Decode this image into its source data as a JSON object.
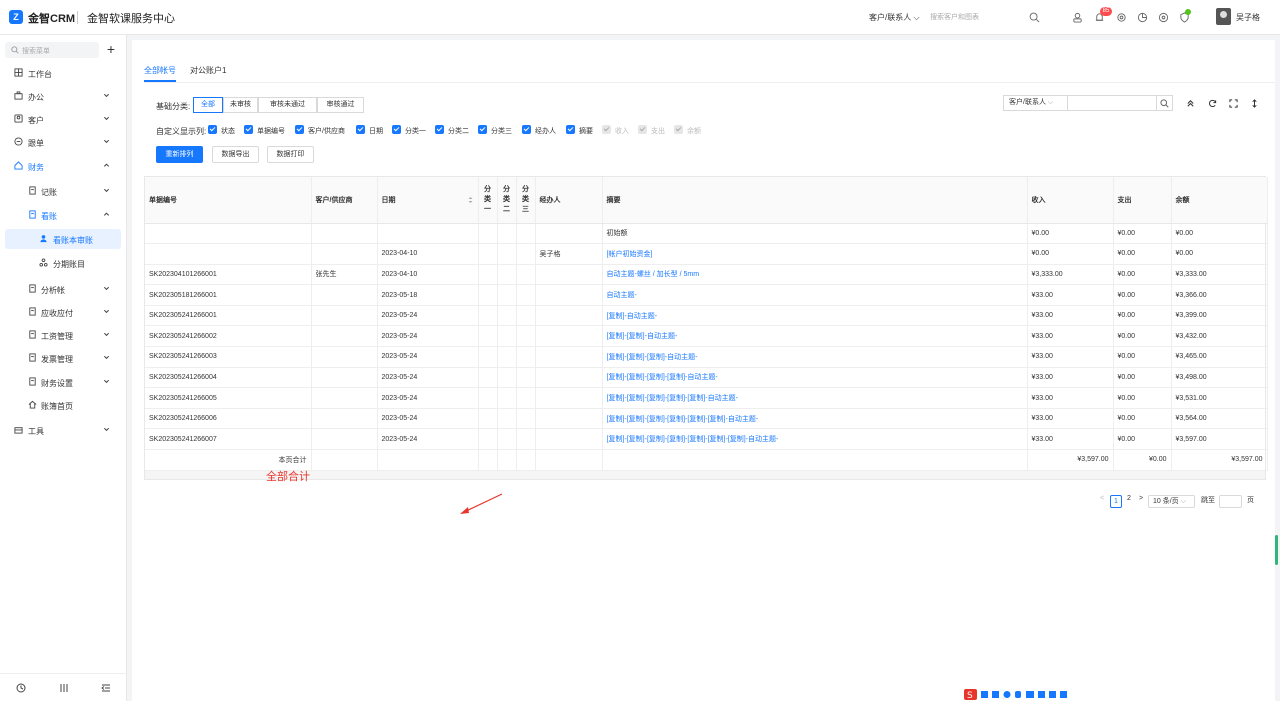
{
  "header": {
    "logo_text": "金智CRM",
    "center_name": "金智软课服务中心",
    "search_type": "客户/联系人",
    "search_placeholder": "搜索客户和图表",
    "notifications_count": "85",
    "user_name": "吴子格"
  },
  "sidebar": {
    "search_placeholder": "搜索菜单",
    "items": [
      {
        "label": "工作台",
        "icon": "grid-icon"
      },
      {
        "label": "办公",
        "icon": "briefcase-icon"
      },
      {
        "label": "客户",
        "icon": "customer-icon"
      },
      {
        "label": "跟单",
        "icon": "follow-icon"
      },
      {
        "label": "财务",
        "icon": "finance-icon"
      },
      {
        "label": "记账",
        "icon": "ledger-icon"
      },
      {
        "label": "看账",
        "icon": "view-ledger-icon"
      },
      {
        "label": "看账本审账",
        "icon": "user-icon"
      },
      {
        "label": "分期账目",
        "icon": "installment-icon"
      },
      {
        "label": "分析帐",
        "icon": "analysis-icon"
      },
      {
        "label": "应收应付",
        "icon": "receivable-icon"
      },
      {
        "label": "工资管理",
        "icon": "salary-icon"
      },
      {
        "label": "发票管理",
        "icon": "invoice-icon"
      },
      {
        "label": "财务设置",
        "icon": "settings-icon"
      },
      {
        "label": "账簿首页",
        "icon": "home-icon"
      },
      {
        "label": "工具",
        "icon": "tool-icon"
      }
    ]
  },
  "tabs": [
    {
      "label": "全部帐号"
    },
    {
      "label": "对公账户1"
    }
  ],
  "filter": {
    "base_label": "基础分类:",
    "segments": [
      "全部",
      "未审核",
      "审核未通过",
      "审核通过"
    ],
    "custom_label": "自定义显示列:",
    "columns": [
      {
        "label": "状态",
        "checked": true
      },
      {
        "label": "单据编号",
        "checked": true
      },
      {
        "label": "客户/供应商",
        "checked": true
      },
      {
        "label": "日期",
        "checked": true
      },
      {
        "label": "分类一",
        "checked": true
      },
      {
        "label": "分类二",
        "checked": true
      },
      {
        "label": "分类三",
        "checked": true
      },
      {
        "label": "经办人",
        "checked": true
      },
      {
        "label": "摘要",
        "checked": true
      },
      {
        "label": "收入",
        "checked": false
      },
      {
        "label": "支出",
        "checked": false
      },
      {
        "label": "余额",
        "checked": false
      }
    ],
    "buttons": [
      "重新排列",
      "数据导出",
      "数据打印"
    ],
    "right_select": "客户/联系人"
  },
  "table": {
    "headers": [
      "单据编号",
      "客户/供应商",
      "日期",
      "分\n类\n一",
      "分\n类\n二",
      "分\n类\n三",
      "经办人",
      "摘要",
      "收入",
      "支出",
      "余额"
    ],
    "rows": [
      [
        "",
        "",
        "",
        "",
        "",
        "",
        "",
        "初始额",
        "¥0.00",
        "¥0.00",
        "¥0.00"
      ],
      [
        "",
        "",
        "2023-04-10",
        "",
        "",
        "",
        "吴子格",
        "[帐户初始资金]",
        "¥0.00",
        "¥0.00",
        "¥0.00"
      ],
      [
        "SK202304101266001",
        "张先生",
        "2023-04-10",
        "",
        "",
        "",
        "",
        "自动主题-螺丝 / 加长型 / 5mm",
        "¥3,333.00",
        "¥0.00",
        "¥3,333.00"
      ],
      [
        "SK202305181266001",
        "",
        "2023-05-18",
        "",
        "",
        "",
        "",
        "自动主题-",
        "¥33.00",
        "¥0.00",
        "¥3,366.00"
      ],
      [
        "SK202305241266001",
        "",
        "2023-05-24",
        "",
        "",
        "",
        "",
        "[复制]-自动主题-",
        "¥33.00",
        "¥0.00",
        "¥3,399.00"
      ],
      [
        "SK202305241266002",
        "",
        "2023-05-24",
        "",
        "",
        "",
        "",
        "[复制]-[复制]-自动主题-",
        "¥33.00",
        "¥0.00",
        "¥3,432.00"
      ],
      [
        "SK202305241266003",
        "",
        "2023-05-24",
        "",
        "",
        "",
        "",
        "[复制]-[复制]-[复制]-自动主题-",
        "¥33.00",
        "¥0.00",
        "¥3,465.00"
      ],
      [
        "SK202305241266004",
        "",
        "2023-05-24",
        "",
        "",
        "",
        "",
        "[复制]-[复制]-[复制]-[复制]-自动主题-",
        "¥33.00",
        "¥0.00",
        "¥3,498.00"
      ],
      [
        "SK202305241266005",
        "",
        "2023-05-24",
        "",
        "",
        "",
        "",
        "[复制]-[复制]-[复制]-[复制]-[复制]-自动主题-",
        "¥33.00",
        "¥0.00",
        "¥3,531.00"
      ],
      [
        "SK202305241266006",
        "",
        "2023-05-24",
        "",
        "",
        "",
        "",
        "[复制]-[复制]-[复制]-[复制]-[复制]-[复制]-自动主题-",
        "¥33.00",
        "¥0.00",
        "¥3,564.00"
      ],
      [
        "SK202305241266007",
        "",
        "2023-05-24",
        "",
        "",
        "",
        "",
        "[复制]-[复制]-[复制]-[复制]-[复制]-[复制]-[复制]-自动主题-",
        "¥33.00",
        "¥0.00",
        "¥3,597.00"
      ]
    ],
    "link_rows": [
      1,
      2,
      3,
      4,
      5,
      6,
      7,
      8,
      9,
      10
    ],
    "total_label": "本页合计",
    "total_income": "¥3,597.00",
    "total_expense": "¥0.00",
    "total_balance": "¥3,597.00"
  },
  "annotation": "全部合计",
  "pagination": {
    "prev": "<",
    "current": "1",
    "page2": "2",
    "next": ">",
    "page_size": "10 条/页",
    "jump_label": "跳至",
    "page_unit": "页"
  },
  "colors": {
    "accent": "#1677ff",
    "annotation": "#e8352b",
    "badge": "#ff4d4f"
  }
}
